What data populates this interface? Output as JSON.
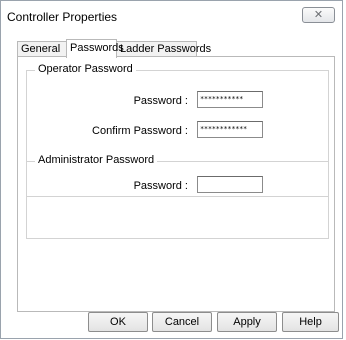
{
  "window": {
    "title": "Controller Properties",
    "close_glyph": "✕"
  },
  "tabs": [
    {
      "label": "General"
    },
    {
      "label": "Passwords"
    },
    {
      "label": "Ladder Passwords"
    }
  ],
  "operator": {
    "legend": "Operator Password",
    "password_label": "Password :",
    "password_value": "***********",
    "confirm_label": "Confirm Password :",
    "confirm_value": "************"
  },
  "administrator": {
    "legend": "Administrator Password",
    "password_label": "Password :",
    "password_value": ""
  },
  "buttons": {
    "ok": "OK",
    "cancel": "Cancel",
    "apply": "Apply",
    "help": "Help"
  }
}
